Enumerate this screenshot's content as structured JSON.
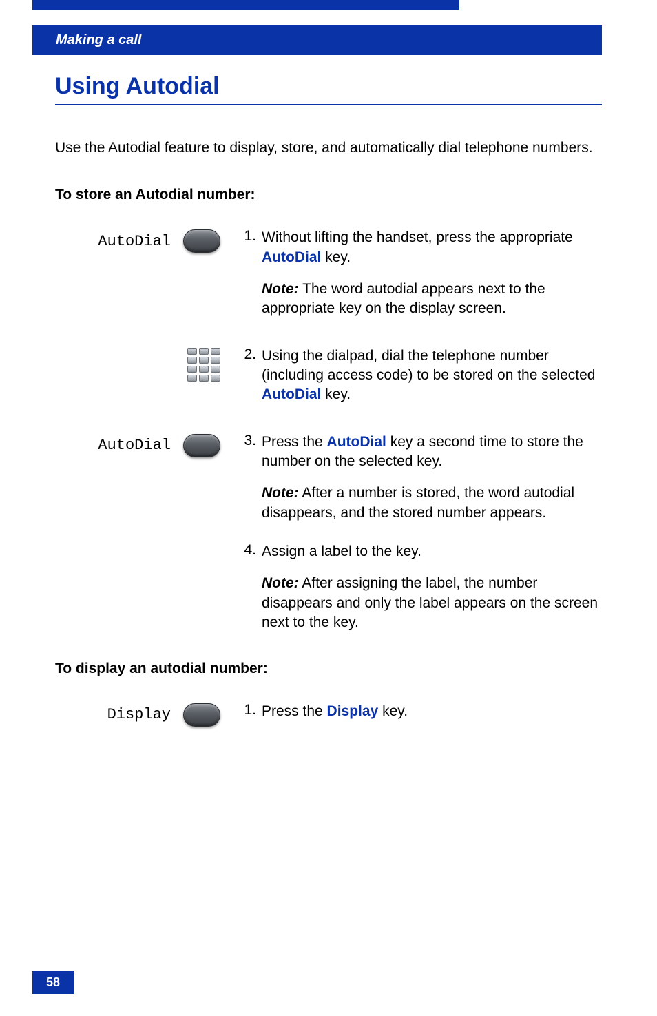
{
  "header": {
    "section": "Making a call"
  },
  "title": "Using Autodial",
  "intro": "Use the Autodial feature to display, store, and automatically dial telephone numbers.",
  "store": {
    "heading": "To store an Autodial number:",
    "steps": [
      {
        "num": "1.",
        "key_label": "AutoDial",
        "body_pre": "Without lifting the handset, press the appropriate ",
        "kw": "AutoDial",
        "body_post": " key.",
        "note_label": "Note:",
        "note": " The word autodial appears next to the appropriate key on the display screen."
      },
      {
        "num": "2.",
        "body_pre": "Using the dialpad, dial the telephone number (including access code) to be stored on the selected ",
        "kw": "AutoDial",
        "body_post": " key."
      },
      {
        "num": "3.",
        "key_label": "AutoDial",
        "body_pre": "Press the ",
        "kw": "AutoDial",
        "body_post": " key a second time to store the number on the selected key.",
        "note_label": "Note:",
        "note": "  After a number is stored, the word autodial disappears, and the stored number appears."
      },
      {
        "num": "4.",
        "body_pre": "Assign a label to the key.",
        "note_label": "Note:",
        "note": " After assigning the label, the number disappears and only the label appears on the screen next to the key."
      }
    ]
  },
  "display": {
    "heading": "To display an autodial number:",
    "steps": [
      {
        "num": "1.",
        "key_label": "Display",
        "body_pre": "Press the ",
        "kw": "Display",
        "body_post": " key."
      }
    ]
  },
  "page_number": "58"
}
